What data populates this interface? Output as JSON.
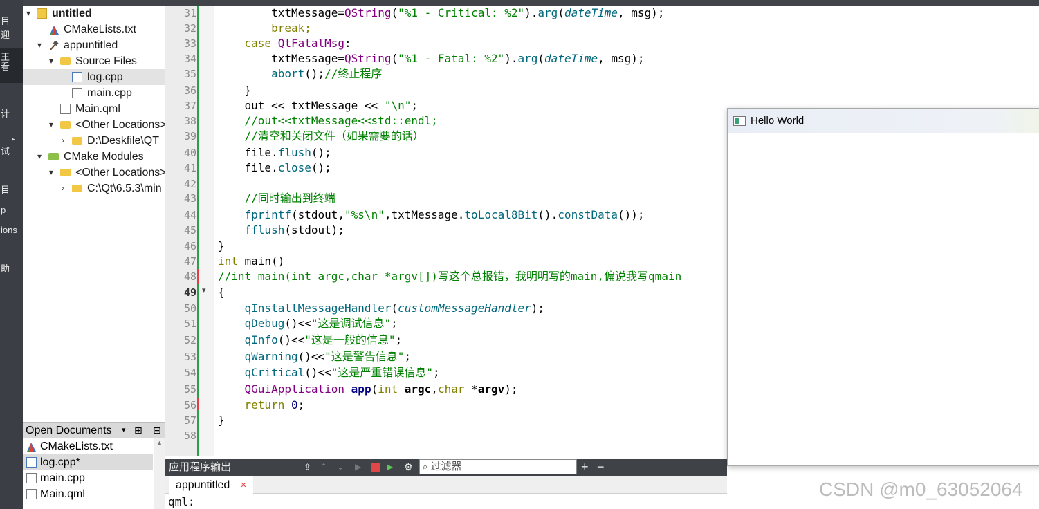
{
  "modebar": {
    "items": [
      "目",
      "迎",
      "王",
      "看",
      "计",
      "试",
      "目",
      "p",
      "ions",
      "助"
    ]
  },
  "tree": {
    "root": "untitled",
    "rows": [
      {
        "label": "untitled",
        "depth": 0,
        "arrow": "▾",
        "icon": "project-icon",
        "bold": true
      },
      {
        "label": "CMakeLists.txt",
        "depth": 1,
        "arrow": "",
        "icon": "cmake-file-icon"
      },
      {
        "label": "appuntitled",
        "depth": 1,
        "arrow": "▾",
        "icon": "hammer-icon"
      },
      {
        "label": "Source Files",
        "depth": 2,
        "arrow": "▾",
        "icon": "folder-icon"
      },
      {
        "label": "log.cpp",
        "depth": 3,
        "arrow": "",
        "icon": "cpp-file-icon",
        "selected": true
      },
      {
        "label": "main.cpp",
        "depth": 3,
        "arrow": "",
        "icon": "cpp-file-icon"
      },
      {
        "label": "Main.qml",
        "depth": 2,
        "arrow": "",
        "icon": "qml-file-icon"
      },
      {
        "label": "<Other Locations>",
        "depth": 2,
        "arrow": "▾",
        "icon": "folder-icon"
      },
      {
        "label": "D:\\Deskfile\\QT",
        "depth": 3,
        "arrow": "›",
        "icon": "folder-icon"
      },
      {
        "label": "CMake Modules",
        "depth": 1,
        "arrow": "▾",
        "icon": "cmake-folder-icon"
      },
      {
        "label": "<Other Locations>",
        "depth": 2,
        "arrow": "▾",
        "icon": "folder-icon"
      },
      {
        "label": "C:\\Qt\\6.5.3\\min",
        "depth": 3,
        "arrow": "›",
        "icon": "folder-icon"
      }
    ]
  },
  "open_documents": {
    "title": "Open Documents",
    "items": [
      {
        "label": "CMakeLists.txt",
        "icon": "cmake-file-icon"
      },
      {
        "label": "log.cpp*",
        "icon": "cpp-file-icon",
        "selected": true
      },
      {
        "label": "main.cpp",
        "icon": "cpp-file-icon"
      },
      {
        "label": "Main.qml",
        "icon": "qml-file-icon"
      }
    ]
  },
  "editor": {
    "current_line": "49",
    "line_numbers": [
      "31",
      "32",
      "33",
      "34",
      "35",
      "36",
      "37",
      "38",
      "39",
      "40",
      "41",
      "42",
      "43",
      "44",
      "45",
      "46",
      "47",
      "48",
      "49",
      "50",
      "51",
      "52",
      "53",
      "54",
      "55",
      "56",
      "57",
      "58"
    ],
    "code": {
      "l31a": "        txtMessage=",
      "l31b": "QString",
      "l31c": "(",
      "l31d": "\"%1 - Critical: %2\"",
      "l31e": ").",
      "l31f": "arg",
      "l31g": "(",
      "l31h": "dateTime",
      "l31i": ", msg);",
      "l32": "        break;",
      "l33a": "    case ",
      "l33b": "QtFatalMsg",
      "l33c": ":",
      "l34a": "        txtMessage=",
      "l34b": "QString",
      "l34c": "(",
      "l34d": "\"%1 - Fatal: %2\"",
      "l34e": ").",
      "l34f": "arg",
      "l34g": "(",
      "l34h": "dateTime",
      "l34i": ", msg);",
      "l35a": "        ",
      "l35b": "abort",
      "l35c": "();",
      "l35d": "//终止程序",
      "l36": "    }",
      "l37a": "    out << txtMessage << ",
      "l37b": "\"\\n\"",
      "l37c": ";",
      "l38": "    //out<<txtMessage<<std::endl;",
      "l39": "    //清空和关闭文件（如果需要的话）",
      "l40a": "    file.",
      "l40b": "flush",
      "l40c": "();",
      "l41a": "    file.",
      "l41b": "close",
      "l41c": "();",
      "l42": "",
      "l43": "    //同时输出到终端",
      "l44a": "    ",
      "l44b": "fprintf",
      "l44c": "(stdout,",
      "l44d": "\"%s\\n\"",
      "l44e": ",txtMessage.",
      "l44f": "toLocal8Bit",
      "l44g": "().",
      "l44h": "constData",
      "l44i": "());",
      "l45a": "    ",
      "l45b": "fflush",
      "l45c": "(stdout);",
      "l46": "}",
      "l47a": "int ",
      "l47b": "main",
      "l47c": "()",
      "l48": "//int main(int argc,char *argv[])写这个总报错，我明明写的main,偏说我写qmain",
      "l49": "{",
      "l50a": "    ",
      "l50b": "qInstallMessageHandler",
      "l50c": "(",
      "l50d": "customMessageHandler",
      "l50e": ");",
      "l51a": "    ",
      "l51b": "qDebug",
      "l51c": "()<<",
      "l51d": "\"这是调试信息\"",
      "l51e": ";",
      "l52a": "    ",
      "l52b": "qInfo",
      "l52c": "()<<",
      "l52d": "\"这是一般的信息\"",
      "l52e": ";",
      "l53a": "    ",
      "l53b": "qWarning",
      "l53c": "()<<",
      "l53d": "\"这是警告信息\"",
      "l53e": ";",
      "l54a": "    ",
      "l54b": "qCritical",
      "l54c": "()<<",
      "l54d": "\"这是严重错误信息\"",
      "l54e": ";",
      "l55a": "    ",
      "l55b": "QGuiApplication",
      "l55c": " ",
      "l55d": "app",
      "l55e": "(",
      "l55f": "int",
      "l55g": " ",
      "l55h": "argc",
      "l55i": ",",
      "l55j": "char",
      "l55k": " *",
      "l55l": "argv",
      "l55m": ");",
      "l56a": "    ",
      "l56b": "return",
      "l56c": " ",
      "l56d": "0",
      "l56e": ";",
      "l57": "}",
      "l58": ""
    }
  },
  "output": {
    "title": "应用程序输出",
    "filter_placeholder": "过滤器",
    "tab_label": "appuntitled",
    "text": "qml:"
  },
  "hello_window": {
    "title": "Hello World"
  },
  "watermark": "CSDN @m0_63052064",
  "colors": {
    "keyword": "#808000",
    "string": "#008000",
    "function": "#00677c",
    "type": "#800080",
    "accent_green": "#2ea043",
    "stop_red": "#e04848"
  }
}
